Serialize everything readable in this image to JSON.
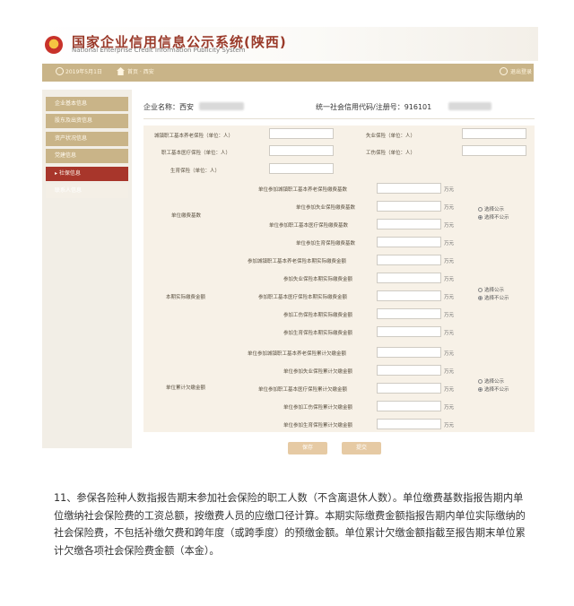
{
  "header": {
    "title": "国家企业信用信息公示系统(陕西)",
    "subtitle": "National Enterprise Credit Information Publicity System"
  },
  "topbar": {
    "date": "2019年5月1日",
    "home": "首页 · 西安",
    "logout": "退出登录"
  },
  "sidebar": {
    "items": [
      {
        "label": "企业基本信息"
      },
      {
        "label": "股东及出资信息"
      },
      {
        "label": "资产状况信息"
      },
      {
        "label": "党建信息"
      },
      {
        "label": "▸ 社保信息"
      },
      {
        "label": "联系人信息"
      }
    ]
  },
  "company": {
    "name_label": "企业名称：西安",
    "uscc_label": "统一社会信用代码/注册号：916101"
  },
  "headcount": {
    "left": [
      {
        "label": "城镇职工基本养老保险（单位：人）"
      },
      {
        "label": "职工基本医疗保险（单位：人）"
      },
      {
        "label": "生育保险（单位：人）"
      }
    ],
    "right": [
      {
        "label": "失业保险（单位：人）"
      },
      {
        "label": "工伤保险（单位：人）"
      }
    ]
  },
  "unit": "万元",
  "visibility": {
    "show": "选择公示",
    "hide": "选择不公示"
  },
  "sections": [
    {
      "category": "单位缴费基数",
      "rows": [
        "单位参加城镇职工基本养老保险缴费基数",
        "单位参加失业保险缴费基数",
        "单位参加职工基本医疗保险缴费基数",
        "单位参加生育保险缴费基数"
      ]
    },
    {
      "category": "本期实际缴费金额",
      "rows": [
        "参加城镇职工基本养老保险本期实际缴费金额",
        "参加失业保险本期实际缴费金额",
        "参加职工基本医疗保险本期实际缴费金额",
        "参加工伤保险本期实际缴费金额",
        "参加生育保险本期实际缴费金额"
      ]
    },
    {
      "category": "单位累计欠缴金额",
      "rows": [
        "单位参加城镇职工基本养老保险累计欠缴金额",
        "单位参加失业保险累计欠缴金额",
        "单位参加职工基本医疗保险累计欠缴金额",
        "单位参加工伤保险累计欠缴金额",
        "单位参加生育保险累计欠缴金额"
      ]
    }
  ],
  "buttons": {
    "save": "保存",
    "submit": "提交"
  },
  "note": "11、参保各险种人数指报告期末参加社会保险的职工人数（不含离退休人数）。单位缴费基数指报告期内单位缴纳社会保险费的工资总额，按缴费人员的应缴口径计算。本期实际缴费金额指报告期内单位实际缴纳的社会保险费，不包括补缴欠费和跨年度（或跨季度）的预缴金额。单位累计欠缴金额指截至报告期末单位累计欠缴各项社会保险费金额（本金）。"
}
